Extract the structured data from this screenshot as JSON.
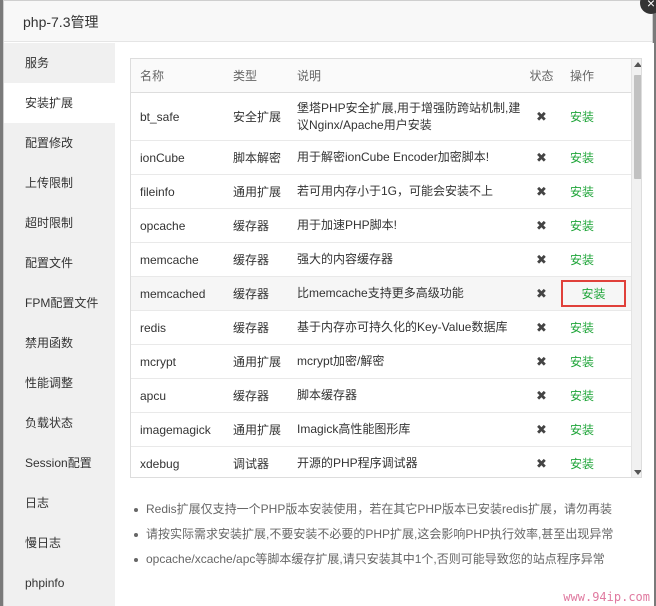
{
  "dialog": {
    "title": "php-7.3管理",
    "close_icon": "×"
  },
  "sidebar": {
    "items": [
      {
        "label": "服务",
        "active": false
      },
      {
        "label": "安装扩展",
        "active": true
      },
      {
        "label": "配置修改",
        "active": false
      },
      {
        "label": "上传限制",
        "active": false
      },
      {
        "label": "超时限制",
        "active": false
      },
      {
        "label": "配置文件",
        "active": false
      },
      {
        "label": "FPM配置文件",
        "active": false
      },
      {
        "label": "禁用函数",
        "active": false
      },
      {
        "label": "性能调整",
        "active": false
      },
      {
        "label": "负载状态",
        "active": false
      },
      {
        "label": "Session配置",
        "active": false
      },
      {
        "label": "日志",
        "active": false
      },
      {
        "label": "慢日志",
        "active": false
      },
      {
        "label": "phpinfo",
        "active": false
      }
    ]
  },
  "table": {
    "headers": {
      "name": "名称",
      "type": "类型",
      "desc": "说明",
      "status": "状态",
      "action": "操作"
    },
    "rows": [
      {
        "name": "bt_safe",
        "type": "安全扩展",
        "desc": "堡塔PHP安全扩展,用于增强防跨站机制,建议Nginx/Apache用户安装",
        "status": "✖",
        "action": "安装"
      },
      {
        "name": "ionCube",
        "type": "脚本解密",
        "desc": "用于解密ionCube Encoder加密脚本!",
        "status": "✖",
        "action": "安装"
      },
      {
        "name": "fileinfo",
        "type": "通用扩展",
        "desc": "若可用内存小于1G，可能会安装不上",
        "status": "✖",
        "action": "安装"
      },
      {
        "name": "opcache",
        "type": "缓存器",
        "desc": "用于加速PHP脚本!",
        "status": "✖",
        "action": "安装"
      },
      {
        "name": "memcache",
        "type": "缓存器",
        "desc": "强大的内容缓存器",
        "status": "✖",
        "action": "安装"
      },
      {
        "name": "memcached",
        "type": "缓存器",
        "desc": "比memcache支持更多高级功能",
        "status": "✖",
        "action": "安装"
      },
      {
        "name": "redis",
        "type": "缓存器",
        "desc": "基于内存亦可持久化的Key-Value数据库",
        "status": "✖",
        "action": "安装"
      },
      {
        "name": "mcrypt",
        "type": "通用扩展",
        "desc": "mcrypt加密/解密",
        "status": "✖",
        "action": "安装"
      },
      {
        "name": "apcu",
        "type": "缓存器",
        "desc": "脚本缓存器",
        "status": "✖",
        "action": "安装"
      },
      {
        "name": "imagemagick",
        "type": "通用扩展",
        "desc": "Imagick高性能图形库",
        "status": "✖",
        "action": "安装"
      },
      {
        "name": "xdebug",
        "type": "调试器",
        "desc": "开源的PHP程序调试器",
        "status": "✖",
        "action": "安装"
      }
    ]
  },
  "notes": [
    "Redis扩展仅支持一个PHP版本安装使用，若在其它PHP版本已安装redis扩展，请勿再装",
    "请按实际需求安装扩展,不要安装不必要的PHP扩展,这会影响PHP执行效率,甚至出现异常",
    "opcache/xcache/apc等脚本缓存扩展,请只安装其中1个,否则可能导致您的站点程序异常"
  ],
  "watermark": "www.94ip.com",
  "colors": {
    "install": "#20a53a",
    "highlight_box": "#e0403a"
  }
}
